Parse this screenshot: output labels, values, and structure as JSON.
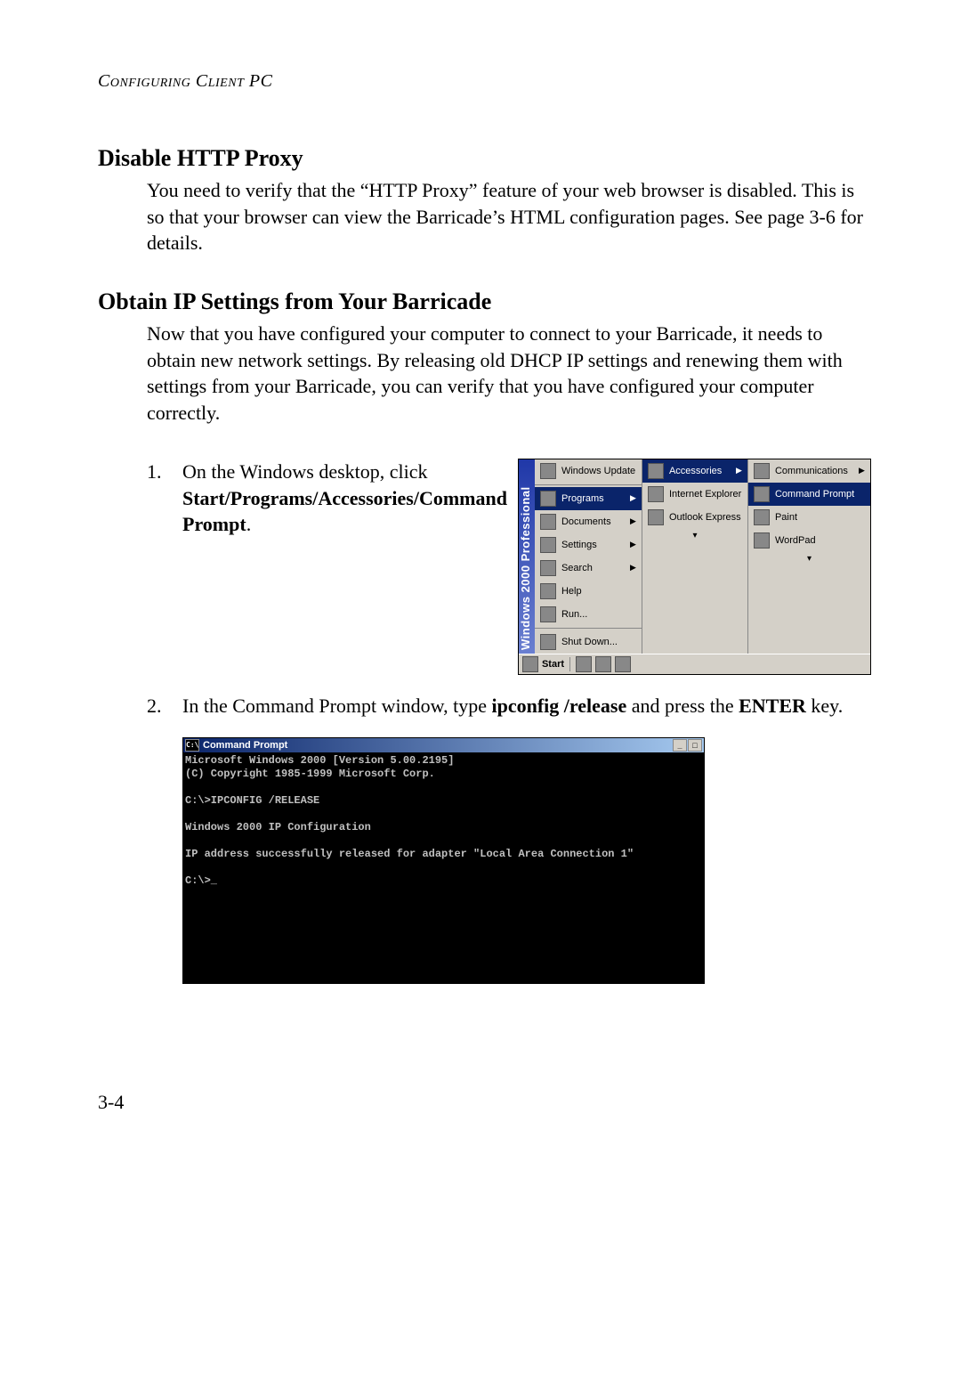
{
  "running_head": "Configuring Client PC",
  "sections": {
    "disable_proxy": {
      "title": "Disable HTTP Proxy",
      "body": "You need to verify that the “HTTP Proxy” feature of your web browser is disabled. This is so that your browser can view the Barricade’s HTML configuration pages. See page 3-6 for details."
    },
    "obtain_ip": {
      "title": "Obtain IP Settings from Your Barricade",
      "body": "Now that you have configured your computer to connect to your Barricade, it needs to obtain new network settings. By releasing old DHCP IP settings and renewing them with settings from your Barricade, you can verify that you have configured your computer correctly."
    }
  },
  "steps": {
    "one": {
      "num": "1.",
      "pre": "On the Windows desktop, click ",
      "bold": "Start/Programs/Accessories/Command Prompt",
      "post": "."
    },
    "two": {
      "num": "2.",
      "pre": "In the Command Prompt window, type ",
      "bold1": "ipconfig /release",
      "mid": " and press the ",
      "bold2": "ENTER",
      "post": " key."
    }
  },
  "start_menu": {
    "stripe": "Windows 2000 Professional",
    "col1": {
      "windows_update": "Windows Update",
      "programs": "Programs",
      "documents": "Documents",
      "settings": "Settings",
      "search": "Search",
      "help": "Help",
      "run": "Run...",
      "shutdown": "Shut Down..."
    },
    "col2": {
      "accessories": "Accessories",
      "ie": "Internet Explorer",
      "outlook": "Outlook Express"
    },
    "col3": {
      "communications": "Communications",
      "cmdprompt": "Command Prompt",
      "paint": "Paint",
      "wordpad": "WordPad"
    },
    "taskbar_start": "Start"
  },
  "cmd_window": {
    "title": "Command Prompt",
    "lines": "Microsoft Windows 2000 [Version 5.00.2195]\n(C) Copyright 1985-1999 Microsoft Corp.\n\nC:\\>IPCONFIG /RELEASE\n\nWindows 2000 IP Configuration\n\nIP address successfully released for adapter \"Local Area Connection 1\"\n\nC:\\>_"
  },
  "page_number": "3-4"
}
